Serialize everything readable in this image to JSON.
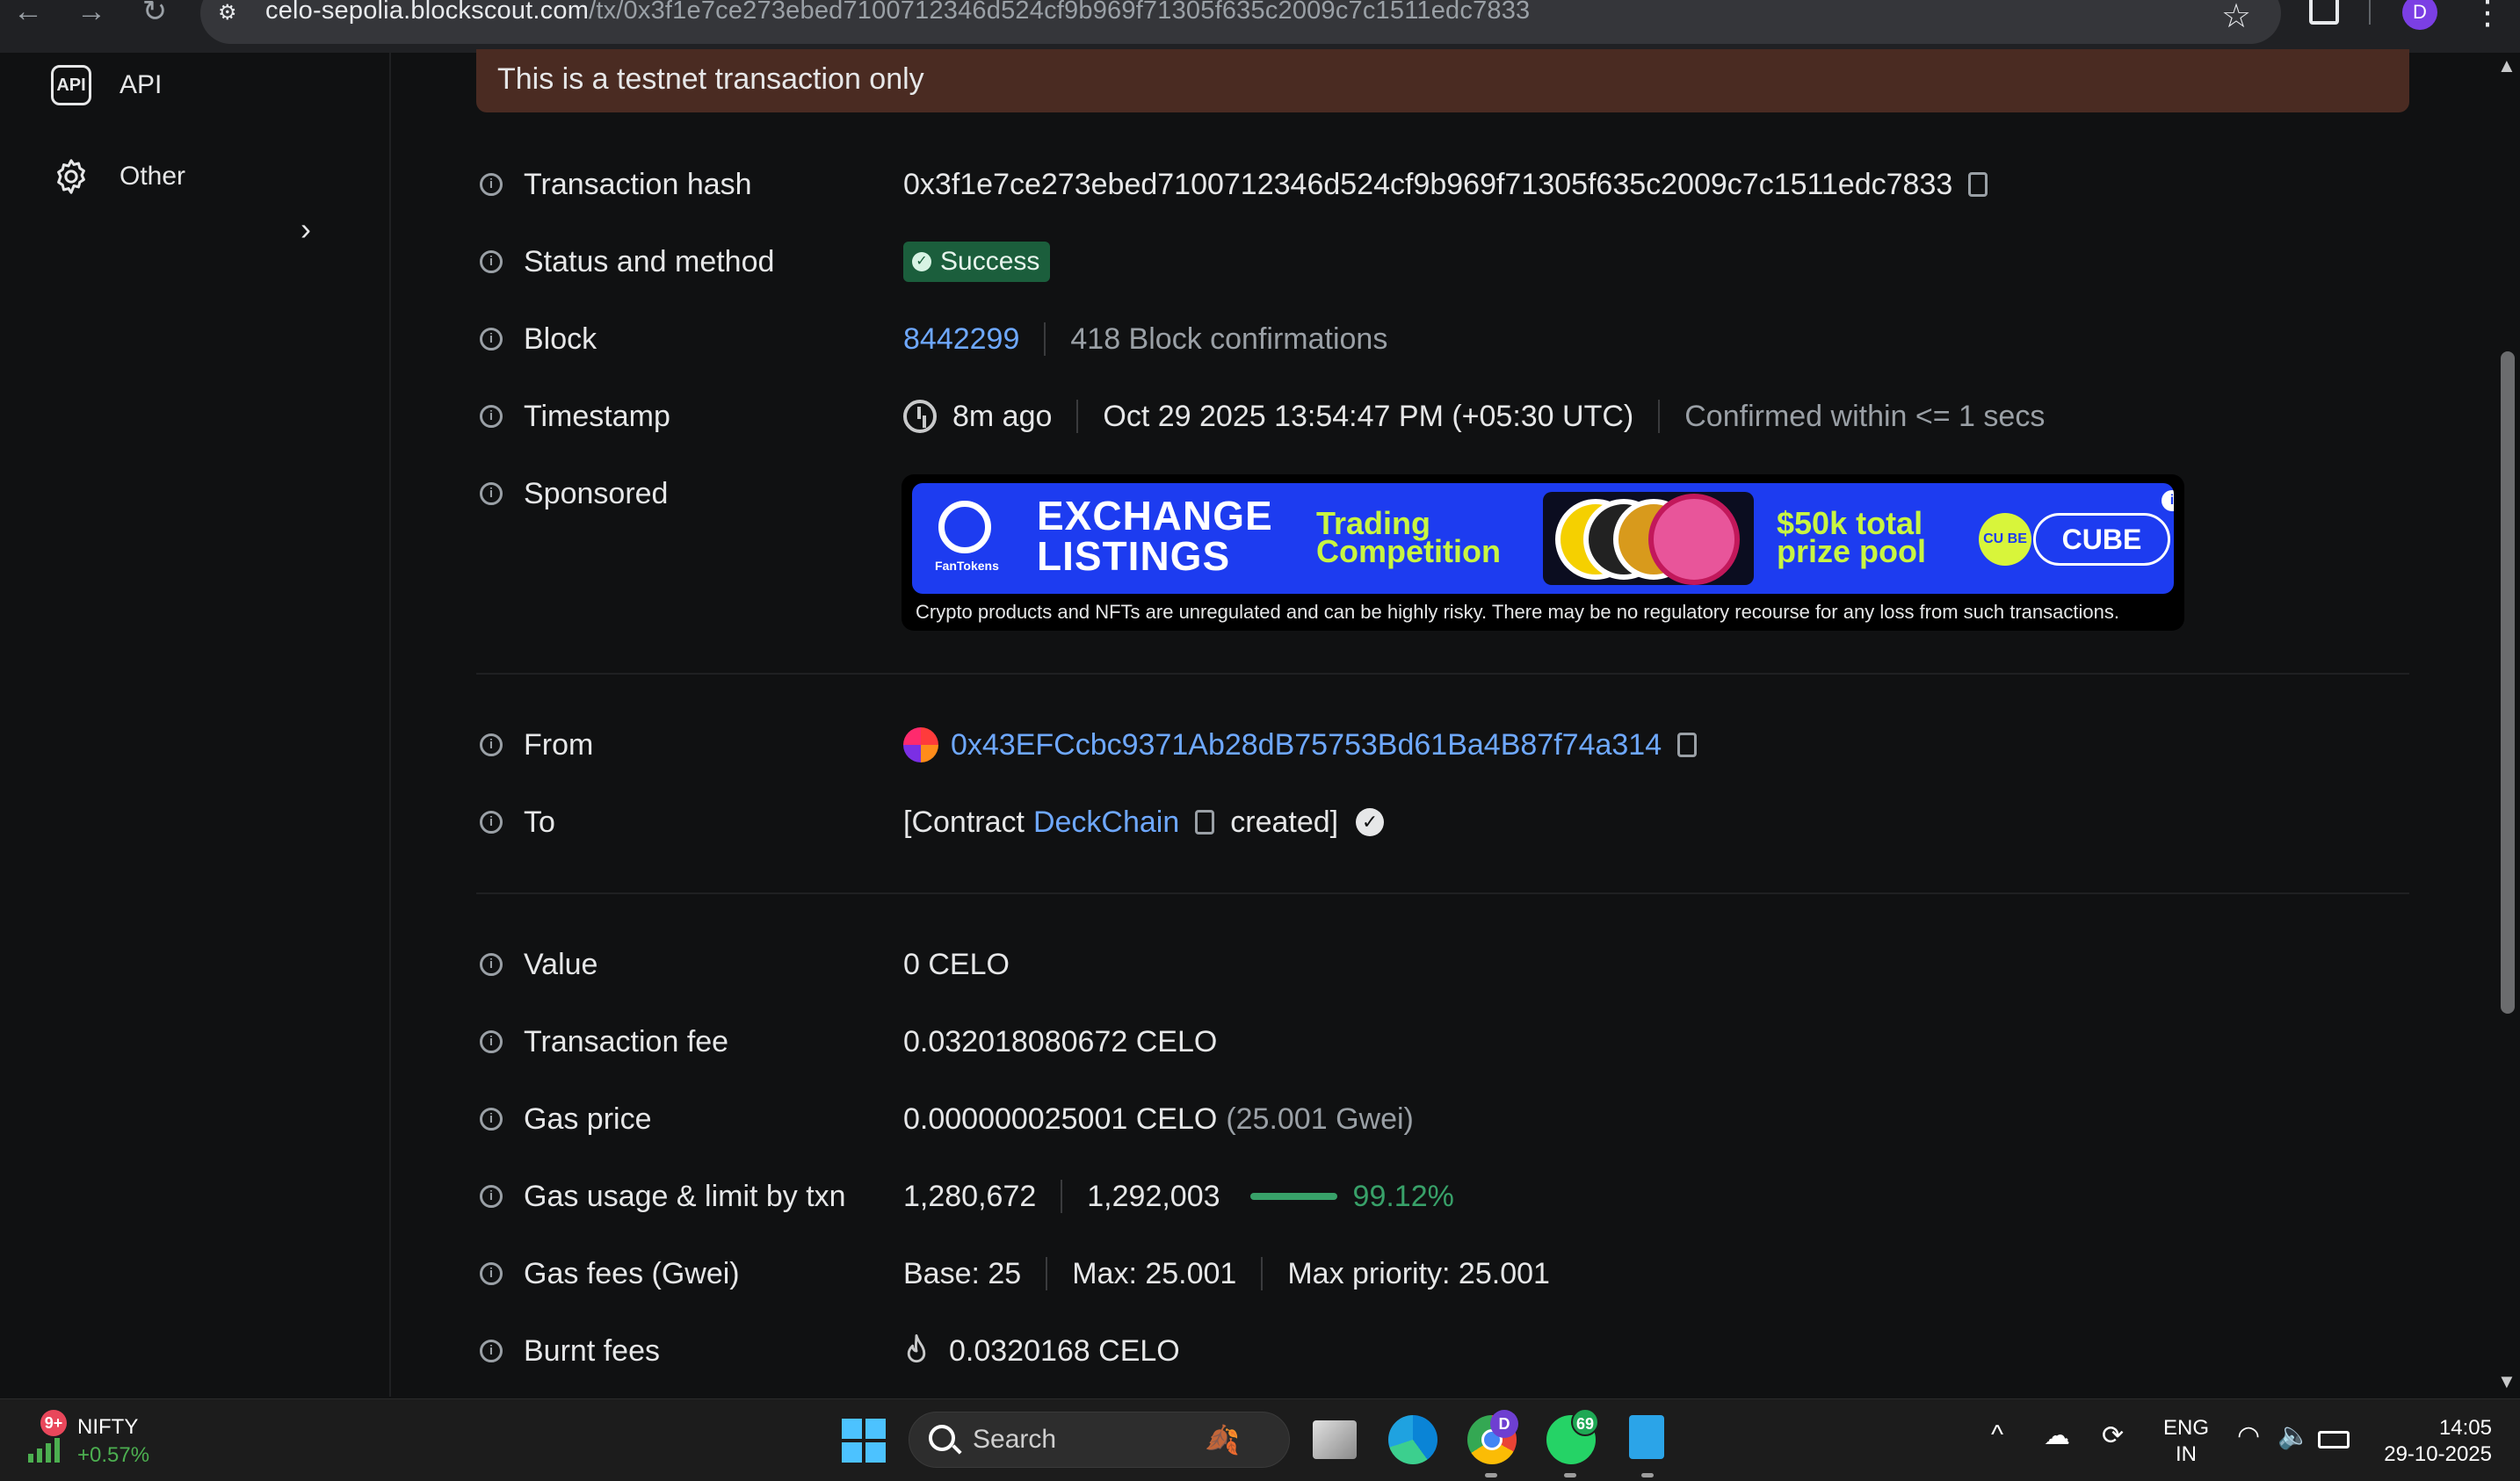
{
  "browser": {
    "url_domain": "celo-sepolia.blockscout.com",
    "url_path": "/tx/0x3f1e7ce273ebed7100712346d524cf9b969f71305f635c2009c7c1511edc7833",
    "profile_initial": "D"
  },
  "sidebar": {
    "items": [
      {
        "label": "API",
        "icon": "api-icon"
      },
      {
        "label": "Other",
        "icon": "gear-icon"
      }
    ]
  },
  "alert": {
    "text": "This is a testnet transaction only"
  },
  "details": {
    "tx_hash": {
      "label": "Transaction hash",
      "value": "0x3f1e7ce273ebed7100712346d524cf9b969f71305f635c2009c7c1511edc7833"
    },
    "status": {
      "label": "Status and method",
      "value": "Success"
    },
    "block": {
      "label": "Block",
      "number": "8442299",
      "confirmations": "418 Block confirmations"
    },
    "timestamp": {
      "label": "Timestamp",
      "ago": "8m ago",
      "datetime": "Oct 29 2025 13:54:47 PM (+05:30 UTC)",
      "confirmed": "Confirmed within <= 1 secs"
    },
    "sponsored": {
      "label": "Sponsored"
    },
    "from": {
      "label": "From",
      "address": "0x43EFCcbc9371Ab28dB75753Bd61Ba4B87f74a314"
    },
    "to": {
      "label": "To",
      "prefix": "[Contract",
      "contract": "DeckChain",
      "suffix": "created]"
    },
    "value": {
      "label": "Value",
      "value": "0 CELO"
    },
    "fee": {
      "label": "Transaction fee",
      "value": "0.032018080672 CELO"
    },
    "gas_price": {
      "label": "Gas price",
      "value": "0.000000025001 CELO",
      "gwei": "(25.001 Gwei)"
    },
    "gas_usage": {
      "label": "Gas usage & limit by txn",
      "used": "1,280,672",
      "limit": "1,292,003",
      "percent": "99.12%",
      "fill_fraction": 0.9912
    },
    "gas_fees": {
      "label": "Gas fees (Gwei)",
      "base": "Base: 25",
      "max": "Max: 25.001",
      "priority": "Max priority: 25.001"
    },
    "burnt": {
      "label": "Burnt fees",
      "value": "0.0320168 CELO"
    }
  },
  "ad": {
    "brand": "FanTokens",
    "headline_1": "EXCHANGE",
    "headline_2": "LISTINGS",
    "sub_1": "Trading",
    "sub_2": "Competition",
    "prize_1": "$50k total",
    "prize_2": "prize pool",
    "cube_logo": "CU BE",
    "cube_label": "CUBE",
    "disclaimer": "Crypto products and NFTs are unregulated and can be highly risky. There may be no regulatory recourse for any loss from such transactions."
  },
  "taskbar": {
    "nifty_badge": "9+",
    "nifty_name": "NIFTY",
    "nifty_change": "+0.57%",
    "search_label": "Search",
    "chrome_badge": "D",
    "whatsapp_badge": "69",
    "lang_1": "ENG",
    "lang_2": "IN",
    "time": "14:05",
    "date": "29-10-2025"
  },
  "colors": {
    "background": "#101112",
    "link": "#6ea8ff",
    "success": "#38a169",
    "alert_bg": "#4a2b22",
    "ad_blue": "#1d3cf0",
    "ad_lime": "#c8f542"
  }
}
